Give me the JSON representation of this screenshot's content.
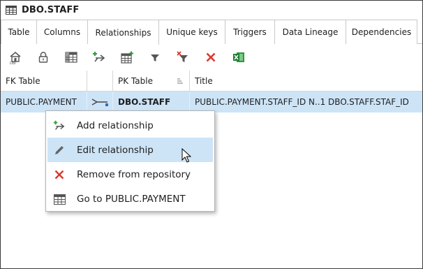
{
  "window": {
    "title": "DBO.STAFF",
    "title_icon": "table-grid-icon"
  },
  "tabs": [
    {
      "label": "Table"
    },
    {
      "label": "Columns"
    },
    {
      "label": "Relationships",
      "active": true
    },
    {
      "label": "Unique keys"
    },
    {
      "label": "Triggers"
    },
    {
      "label": "Data Lineage"
    },
    {
      "label": "Dependencies"
    }
  ],
  "toolbar": {
    "buttons": [
      {
        "icon": "home-schema-icon"
      },
      {
        "icon": "lock-icon"
      },
      {
        "icon": "table-view-icon"
      },
      {
        "icon": "add-relationship-icon"
      },
      {
        "icon": "add-table-icon"
      },
      {
        "icon": "filter-icon"
      },
      {
        "icon": "clear-filter-icon"
      },
      {
        "icon": "delete-icon"
      },
      {
        "icon": "excel-export-icon"
      }
    ]
  },
  "grid": {
    "headers": {
      "fk_table": "FK Table",
      "relation": "",
      "pk_table": "PK Table",
      "title": "Title"
    },
    "rows": [
      {
        "fk_table": "PUBLIC.PAYMENT",
        "pk_table": "DBO.STAFF",
        "title": "PUBLIC.PAYMENT.STAFF_ID N..1 DBO.STAFF.STAF_ID"
      }
    ]
  },
  "context_menu": {
    "items": [
      {
        "label": "Add relationship",
        "icon": "add-relationship-icon"
      },
      {
        "label": "Edit relationship",
        "icon": "pencil-icon",
        "hovered": true
      },
      {
        "label": "Remove from repository",
        "icon": "red-x-icon"
      },
      {
        "label": "Go to PUBLIC.PAYMENT",
        "icon": "table-grid-icon"
      }
    ]
  },
  "colors": {
    "selection": "#cde4f7",
    "green_accent": "#2e9a3a",
    "red_accent": "#d83a2c",
    "icon_gray": "#5a5a5a"
  }
}
